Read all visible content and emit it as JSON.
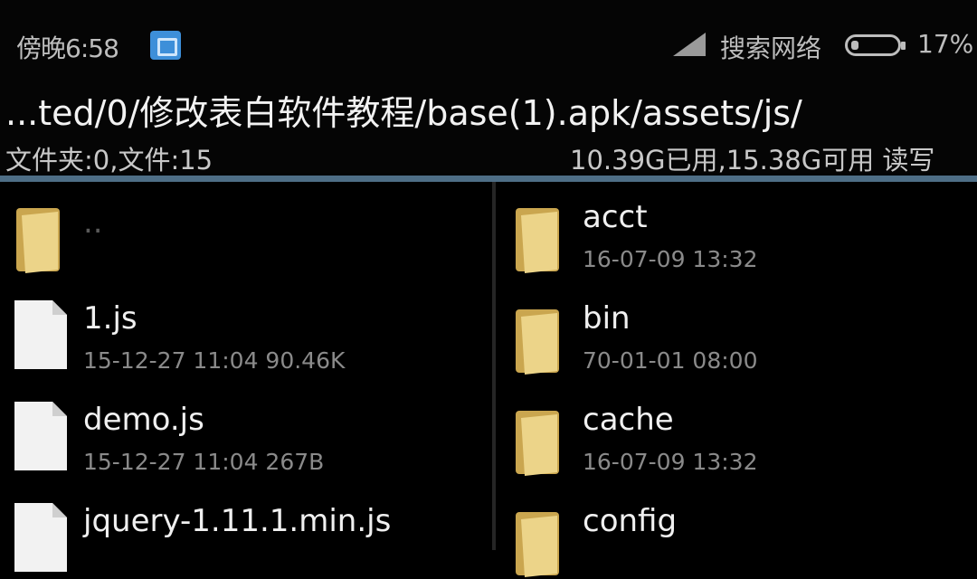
{
  "status_bar": {
    "time": "傍晚6:58",
    "carrier": "搜索网络",
    "battery": "17%",
    "icons": [
      "app-notification-icon",
      "signal-icon",
      "battery-icon"
    ]
  },
  "path_bar": {
    "path": "...ted/0/修改表白软件教程/base(1).apk/assets/js/"
  },
  "info_bar": {
    "counts": "文件夹:0,文件:15",
    "storage": "10.39G已用,15.38G可用 读写"
  },
  "left_column": [
    {
      "name": "..",
      "meta": "",
      "icon": "folder-icon"
    },
    {
      "name": "1.js",
      "meta": "15-12-27 11:04  90.46K",
      "icon": "document-icon"
    },
    {
      "name": "demo.js",
      "meta": "15-12-27 11:04  267B",
      "icon": "document-icon"
    },
    {
      "name": "jquery-1.11.1.min.js",
      "meta": "",
      "icon": "document-icon"
    }
  ],
  "right_column": [
    {
      "name": "acct",
      "meta": "16-07-09 13:32",
      "icon": "folder-icon"
    },
    {
      "name": "bin",
      "meta": "70-01-01 08:00",
      "icon": "folder-icon"
    },
    {
      "name": "cache",
      "meta": "16-07-09 13:32",
      "icon": "folder-icon"
    },
    {
      "name": "config",
      "meta": "",
      "icon": "folder-icon"
    }
  ],
  "colors": {
    "background": "#000000",
    "divider": "#4e6e86",
    "folder": "#e8cf7a",
    "document": "#f2f2f2"
  }
}
